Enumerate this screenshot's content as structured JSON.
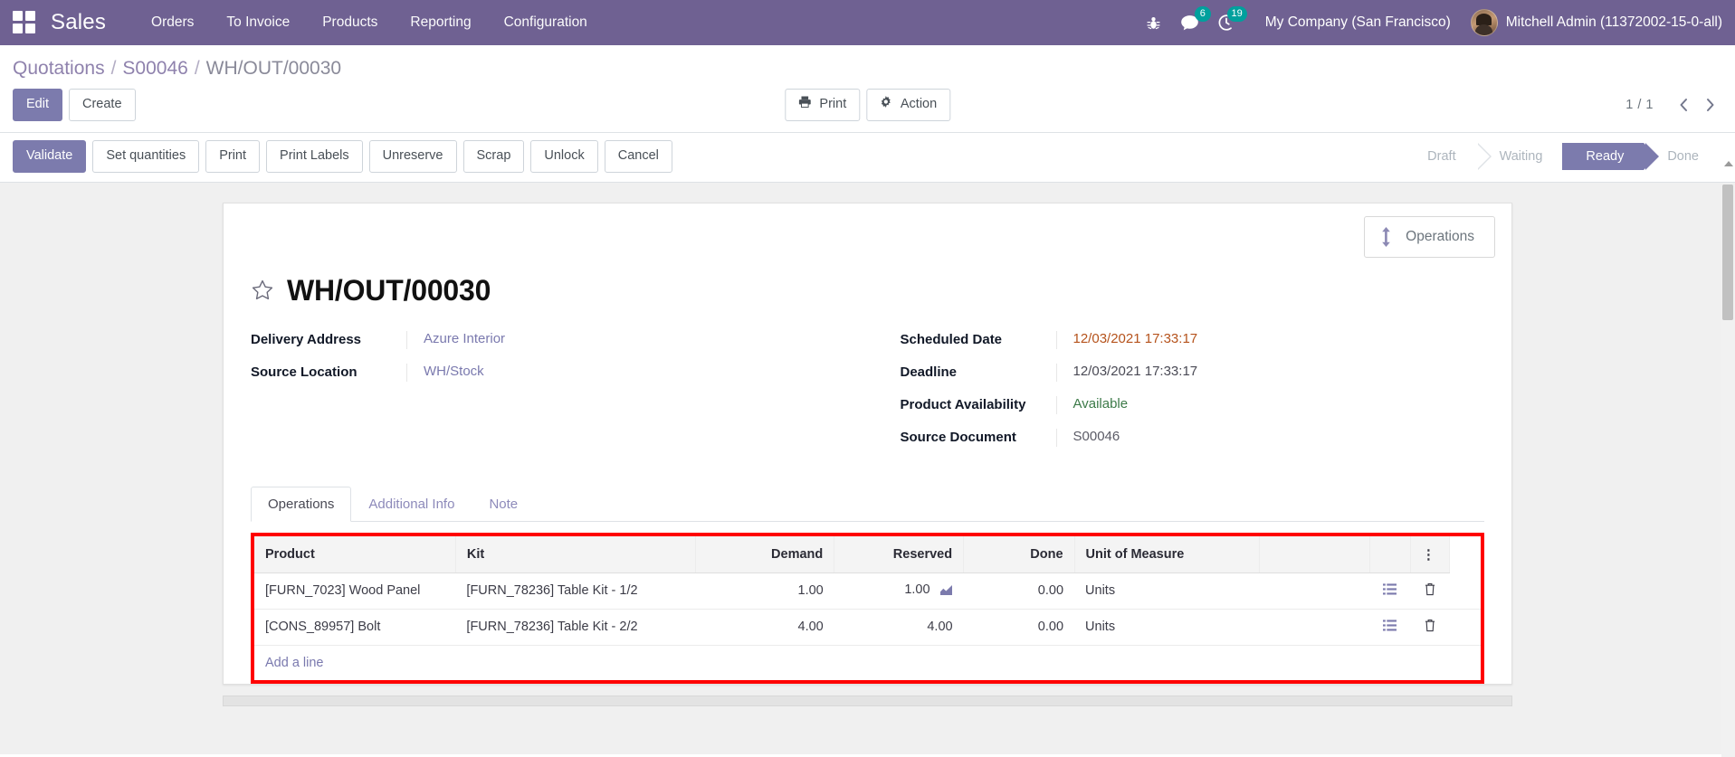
{
  "navbar": {
    "apps_icon": "apps-grid-icon",
    "brand": "Sales",
    "menu": [
      {
        "label": "Orders"
      },
      {
        "label": "To Invoice"
      },
      {
        "label": "Products"
      },
      {
        "label": "Reporting"
      },
      {
        "label": "Configuration"
      }
    ],
    "debug_icon": "bug-icon",
    "messages_icon": "messages-icon",
    "messages_count": "6",
    "activities_icon": "clock-icon",
    "activities_count": "19",
    "company": "My Company (San Francisco)",
    "user": "Mitchell Admin (11372002-15-0-all)",
    "accent_color": "#6f6192",
    "badge_color": "#00a09d"
  },
  "breadcrumb": {
    "items": [
      "Quotations",
      "S00046",
      "WH/OUT/00030"
    ],
    "separator": "/"
  },
  "control_panel": {
    "edit_label": "Edit",
    "create_label": "Create",
    "print_label": "Print",
    "print_icon": "printer-icon",
    "action_label": "Action",
    "action_icon": "gear-icon",
    "pager_value": "1 / 1",
    "prev_icon": "chevron-left-icon",
    "next_icon": "chevron-right-icon"
  },
  "statusbar": {
    "buttons": [
      {
        "label": "Validate",
        "primary": true
      },
      {
        "label": "Set quantities",
        "primary": false
      },
      {
        "label": "Print",
        "primary": false
      },
      {
        "label": "Print Labels",
        "primary": false
      },
      {
        "label": "Unreserve",
        "primary": false
      },
      {
        "label": "Scrap",
        "primary": false
      },
      {
        "label": "Unlock",
        "primary": false
      },
      {
        "label": "Cancel",
        "primary": false
      }
    ],
    "stages": [
      {
        "label": "Draft",
        "active": false
      },
      {
        "label": "Waiting",
        "active": false
      },
      {
        "label": "Ready",
        "active": true
      },
      {
        "label": "Done",
        "active": false
      }
    ],
    "active_color": "#7c7bad"
  },
  "form": {
    "smart_button": {
      "label": "Operations",
      "icon": "arrows-vertical-icon"
    },
    "favorite_icon": "star-outline-icon",
    "title": "WH/OUT/00030",
    "left_fields": [
      {
        "label": "Delivery Address",
        "value": "Azure Interior",
        "style": "link"
      },
      {
        "label": "Source Location",
        "value": "WH/Stock",
        "style": "link"
      }
    ],
    "right_fields": [
      {
        "label": "Scheduled Date",
        "value": "12/03/2021 17:33:17",
        "style": "warn"
      },
      {
        "label": "Deadline",
        "value": "12/03/2021 17:33:17",
        "style": "plain"
      },
      {
        "label": "Product Availability",
        "value": "Available",
        "style": "ok"
      },
      {
        "label": "Source Document",
        "value": "S00046",
        "style": "muted"
      }
    ]
  },
  "notebook": {
    "tabs": [
      {
        "label": "Operations",
        "active": true
      },
      {
        "label": "Additional Info",
        "active": false
      },
      {
        "label": "Note",
        "active": false
      }
    ]
  },
  "operations_table": {
    "highlight_color": "#ff0000",
    "columns": [
      "Product",
      "Kit",
      "Demand",
      "Reserved",
      "Done",
      "Unit of Measure"
    ],
    "optional_columns_icon": "dots-vertical-icon",
    "rows": [
      {
        "product": "[FURN_7023] Wood Panel",
        "kit": "[FURN_78236] Table Kit - 1/2",
        "demand": "1.00",
        "reserved": "1.00",
        "reserved_icon": "traceability-chart-icon",
        "done": "0.00",
        "uom": "Units",
        "detail_icon": "list-icon",
        "delete_icon": "trash-icon"
      },
      {
        "product": "[CONS_89957] Bolt",
        "kit": "[FURN_78236] Table Kit - 2/2",
        "demand": "4.00",
        "reserved": "4.00",
        "reserved_icon": "",
        "done": "0.00",
        "uom": "Units",
        "detail_icon": "list-icon",
        "delete_icon": "trash-icon"
      }
    ],
    "add_line_label": "Add a line"
  }
}
